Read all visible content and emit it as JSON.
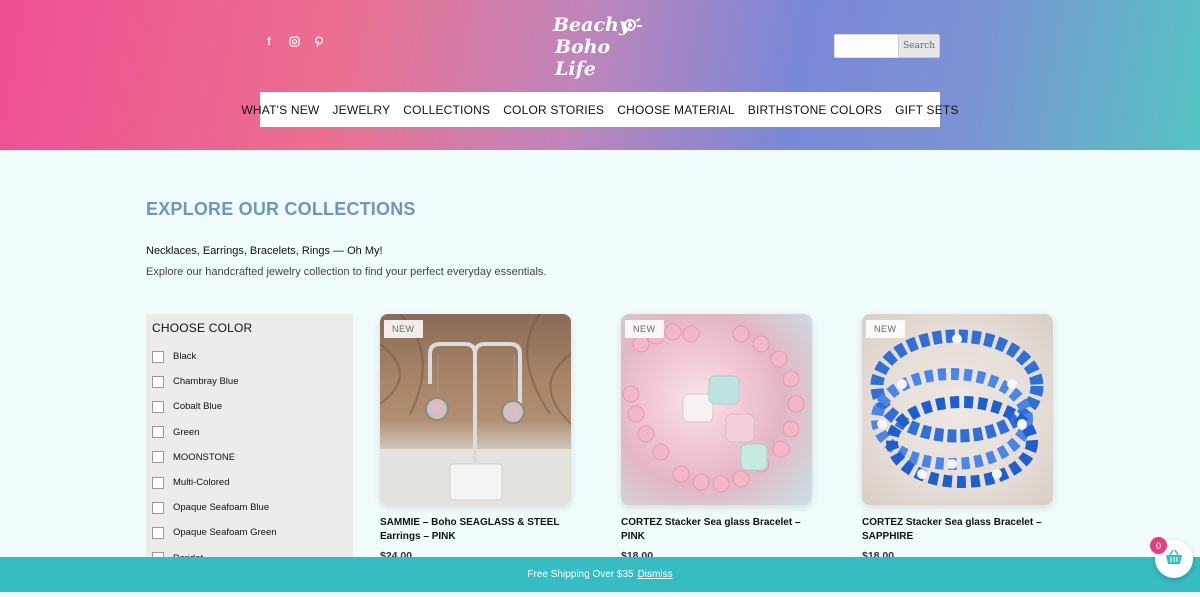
{
  "header": {
    "logo_line1": "Beachy",
    "logo_line2": "Boho Life",
    "social_icons": [
      "facebook-icon",
      "instagram-icon",
      "pinterest-icon"
    ],
    "search_placeholder": "",
    "search_button": "Search",
    "nav": [
      "WHAT'S NEW",
      "JEWELRY",
      "COLLECTIONS",
      "COLOR STORIES",
      "CHOOSE MATERIAL",
      "BIRTHSTONE COLORS",
      "GIFT SETS"
    ]
  },
  "main": {
    "title": "EXPLORE OUR COLLECTIONS",
    "subtitle_bold": "Necklaces, Earrings, Bracelets, Rings — Oh My!",
    "subtitle_text": "Explore our handcrafted jewelry collection to find your perfect everyday essentials."
  },
  "filter": {
    "title": "CHOOSE COLOR",
    "options": [
      "Black",
      "Chambray Blue",
      "Cobalt Blue",
      "Green",
      "MOONSTONE",
      "Multi-Colored",
      "Opaque Seafoam Blue",
      "Opaque Seafoam Green",
      "Peridot"
    ]
  },
  "products": [
    {
      "badge": "NEW",
      "name": "SAMMIE – Boho SEAGLASS & STEEL Earrings – PINK",
      "price": "$24.00"
    },
    {
      "badge": "NEW",
      "name": "CORTEZ Stacker Sea glass Bracelet – PINK",
      "price": "$18.00"
    },
    {
      "badge": "NEW",
      "name": "CORTEZ Stacker Sea glass Bracelet – SAPPHIRE",
      "price": "$18.00"
    }
  ],
  "banner": {
    "text": "Free Shipping Over $35",
    "dismiss": "Dismiss"
  },
  "cart": {
    "count": "0"
  },
  "colors": {
    "accent_title": "#6a98c3",
    "banner": "#35bdc3",
    "cart_badge": "#e23f82"
  }
}
